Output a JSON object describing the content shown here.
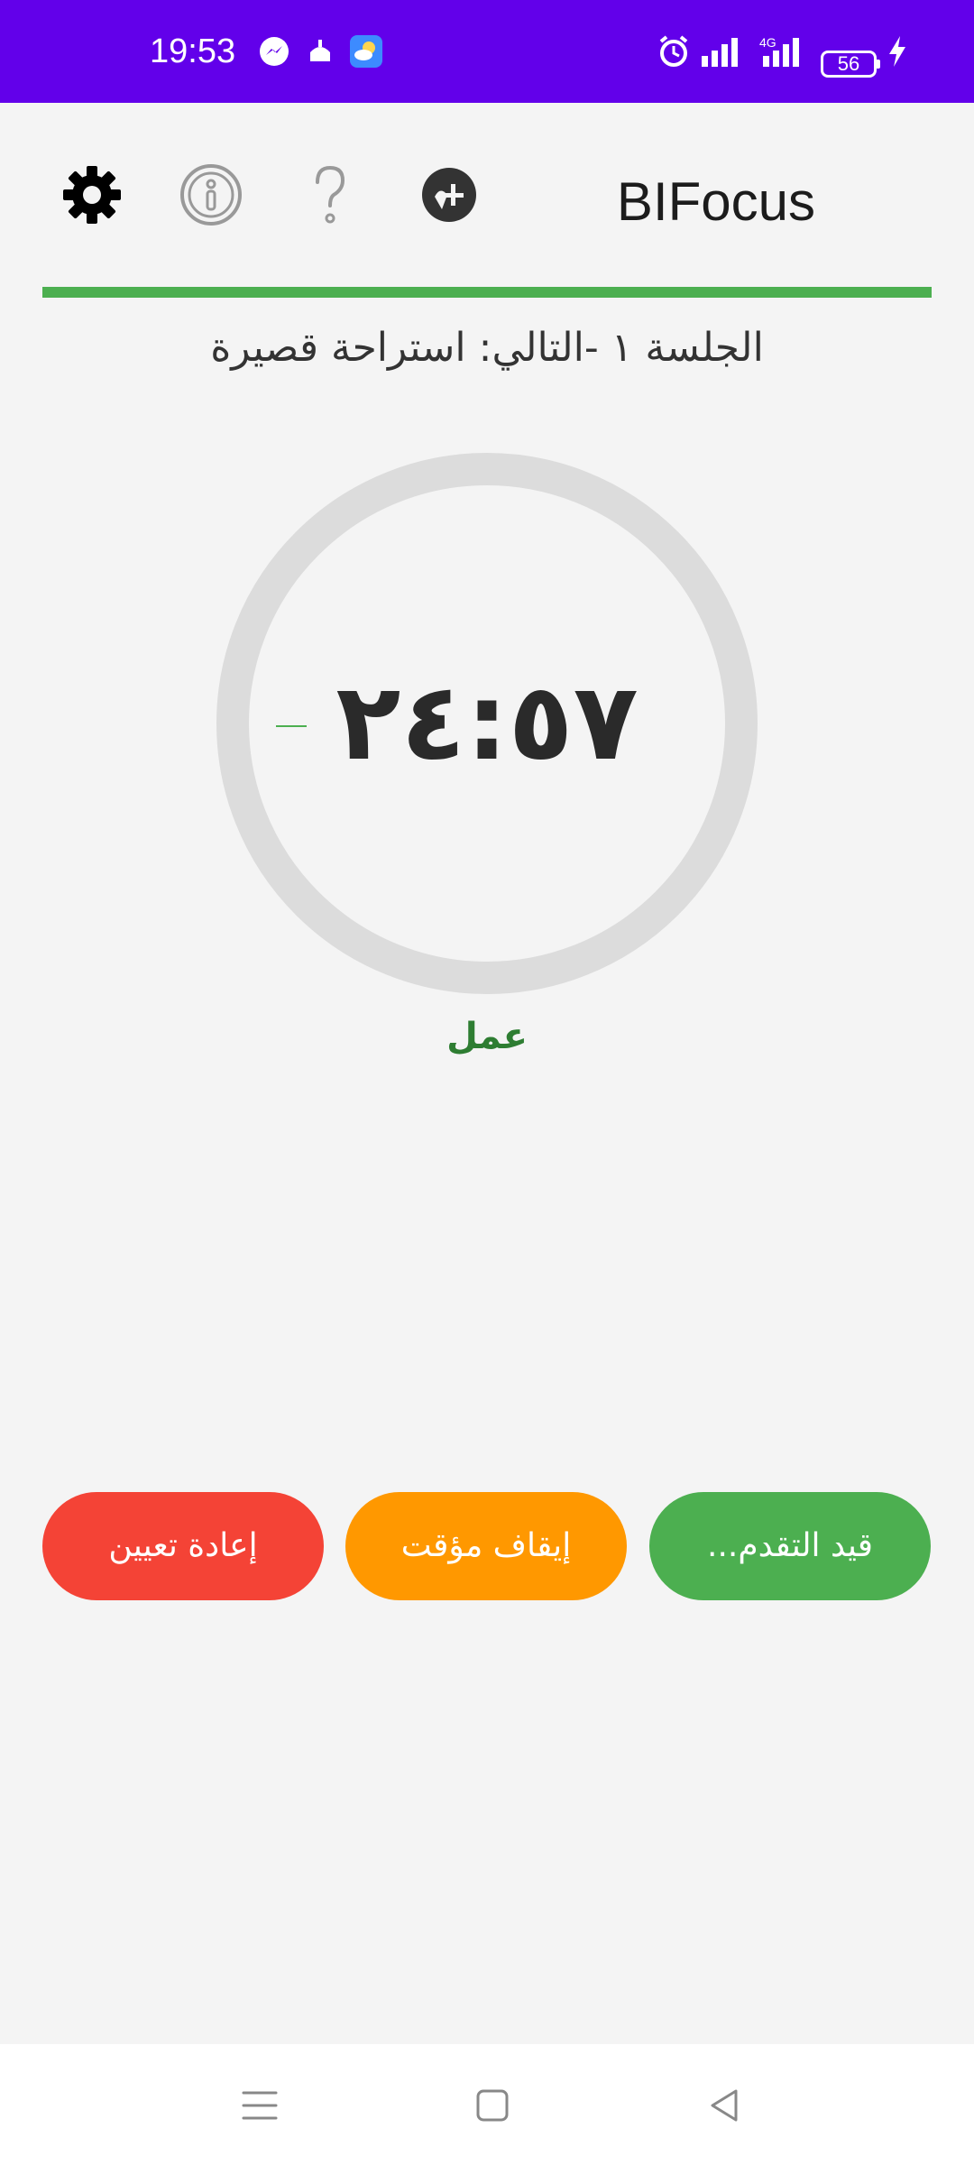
{
  "status_bar": {
    "time": "19:53",
    "battery": "56",
    "network": "4G",
    "icons": [
      "messenger-icon",
      "prayer-app-icon",
      "weather-icon",
      "alarm-icon",
      "signal-icon",
      "signal-4g-icon",
      "battery-icon",
      "charging-icon"
    ]
  },
  "toolbar": {
    "title": "BIFocus",
    "icons": [
      "settings-icon",
      "info-icon",
      "help-icon",
      "add-icon"
    ]
  },
  "session": {
    "label": "الجلسة ١ -التالي: استراحة قصيرة"
  },
  "timer": {
    "time": "٢٤:٥٧",
    "mode": "عمل",
    "progress": 0.002
  },
  "buttons": {
    "reset": "إعادة تعيين",
    "pause": "إيقاف مؤقت",
    "progress": "قيد التقدم..."
  },
  "colors": {
    "status_bar": "#6200ea",
    "accent_green": "#4caf50",
    "mode_green": "#2e7d32",
    "reset_red": "#f44336",
    "pause_orange": "#ff9800",
    "ring_gray": "#dcdcdc"
  }
}
